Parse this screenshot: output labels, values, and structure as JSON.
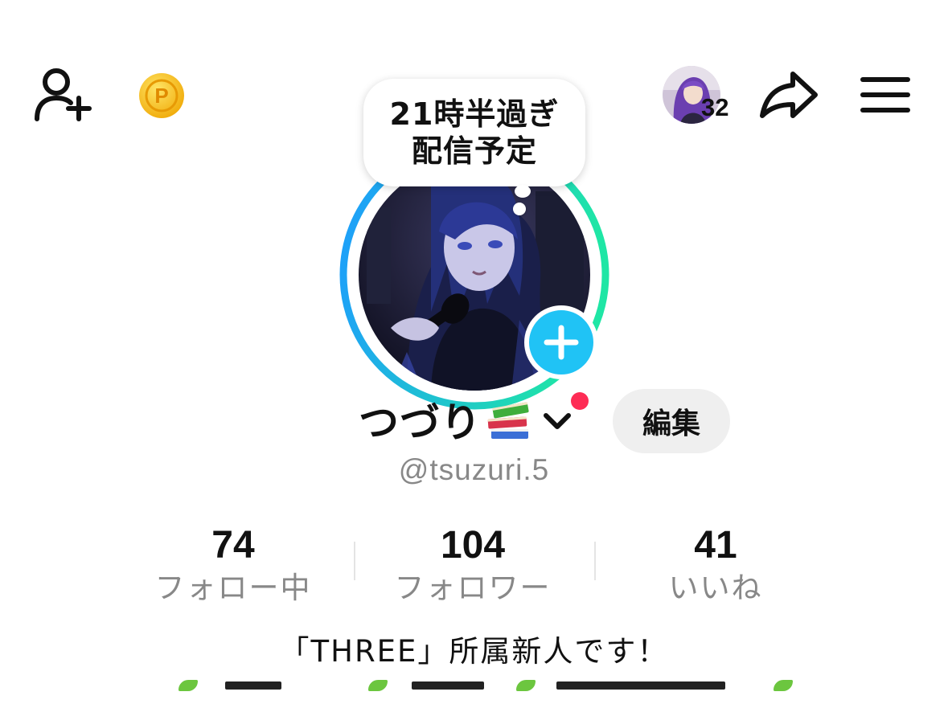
{
  "topbar": {
    "add_friend_icon": "person-plus-icon",
    "coin_icon": "coin-icon",
    "coin_glyph": "P",
    "viewer_count": "32",
    "share_icon": "share-arrow-icon",
    "menu_icon": "hamburger-menu-icon"
  },
  "profile": {
    "note_line1": "21時半過ぎ",
    "note_line2": "配信予定",
    "name": "つづり",
    "name_emoji_icon": "books-icon",
    "edit_label": "編集",
    "handle": "@tsuzuri.5",
    "bio": "「THREE」所属新人です！"
  },
  "stats": [
    {
      "value": "74",
      "label": "フォロー中"
    },
    {
      "value": "104",
      "label": "フォロワー"
    },
    {
      "value": "41",
      "label": "いいね"
    }
  ],
  "colors": {
    "accent_cyan": "#20c3f5",
    "ring_start": "#1e9bff",
    "ring_end": "#1fe6a5",
    "notification_dot": "#fe2c55",
    "coin": "#f5c21b"
  }
}
